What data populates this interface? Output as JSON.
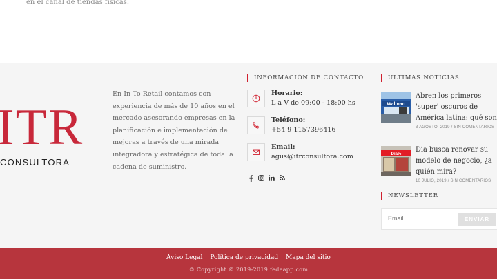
{
  "top": {
    "text": "en el canal de tiendas físicas."
  },
  "logo": {
    "mark": "ITR",
    "subtitle": "CONSULTORA"
  },
  "about": {
    "text": "En In To Retail contamos con experiencia de más de 10 años en el mercado asesorando empresas en la planificación e implementación de mejoras a través de una mirada integradora y estratégica de toda la cadena de suministro."
  },
  "contact": {
    "title": "INFORMACIÓN DE CONTACTO",
    "items": [
      {
        "icon": "clock-icon",
        "label": "Horario:",
        "value": "L a V de 09:00 - 18:00 hs"
      },
      {
        "icon": "phone-icon",
        "label": "Teléfono:",
        "value": "+54 9 1157396416"
      },
      {
        "icon": "envelope-icon",
        "label": "Email:",
        "value": "agus@itrconsultora.com"
      }
    ],
    "social": [
      "facebook-icon",
      "instagram-icon",
      "linkedin-icon",
      "rss-icon"
    ]
  },
  "news": {
    "title": "ULTIMAS NOTICIAS",
    "items": [
      {
        "headline": "Abren los primeros 'super' oscuros de América latina: qué son",
        "date": "3 AGOSTO, 2019",
        "comments": "SIN COMENTARIOS"
      },
      {
        "headline": "Dia busca renovar su modelo de negocio, ¿a quién mira?",
        "date": "10 JULIO, 2019",
        "comments": "SIN COMENTARIOS"
      }
    ]
  },
  "newsletter": {
    "title": "NEWSLETTER",
    "placeholder": "Email",
    "button": "ENVIAR"
  },
  "bottom": {
    "links": [
      "Aviso Legal",
      "Política de privacidad",
      "Mapa del sitio"
    ],
    "copyright": "© Copyright © 2019-2019 fedeapp.com"
  },
  "colors": {
    "accent": "#c8283a",
    "footer_bar": "#b7353d",
    "footer_bg": "#f5f5f5"
  }
}
